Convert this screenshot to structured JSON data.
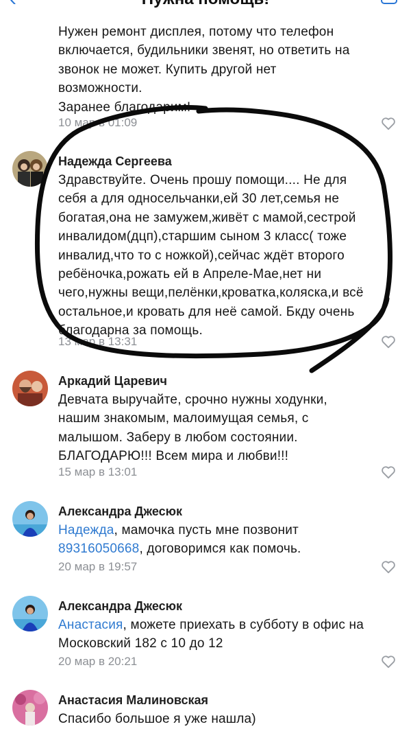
{
  "header": {
    "title": "Нужна помощь!"
  },
  "comments": [
    {
      "author": "",
      "lines": [
        "Нужен ремонт дисплея, потому что телефон",
        "включается, будильники звенят, но ответить на",
        "звонок не может. Купить другой нет",
        "возможности.",
        "Заранее благодарим!"
      ],
      "date": "10 мар в 01:09"
    },
    {
      "author": "Надежда Сергеева",
      "lines": [
        "Здравствуйте. Очень прошу помощи.... Не для",
        "себя а для односельчанки,ей 30 лет,семья не",
        "богатая,она не замужем,живёт с мамой,сестрой",
        "инвалидом(дцп),старшим сыном 3 класс( тоже",
        "инвалид,что то с ножкой),сейчас ждёт второго",
        "ребёночка,рожать ей в Апреле-Мае,нет ни",
        "чего,нужны вещи,пелёнки,кроватка,коляска,и всё",
        "остальное,и кровать для неё самой. Бкду очень",
        "благодарна за помощь."
      ],
      "date": "13 мар в 13:31"
    },
    {
      "author": "Аркадий Царевич",
      "lines": [
        "Девчата выручайте, срочно нужны ходунки,",
        "нашим знакомым, малоимущая семья, с",
        "малышом. Заберу в любом состоянии.",
        "БЛАГОДАРЮ!!! Всем мира и любви!!!"
      ],
      "date": "15 мар в 13:01"
    },
    {
      "author": "Александра Джесюк",
      "mention": "Надежда",
      "line1_rest": ", мамочка пусть мне позвонит",
      "phone": "89316050668",
      "line2_rest": ", договоримся как помочь.",
      "date": "20 мар в 19:57"
    },
    {
      "author": "Александра Джесюк",
      "mention": "Анастасия",
      "line1_rest": ", можете приехать в субботу в офис на",
      "line2": "Московский 182 с 10 до 12",
      "date": "20 мар в 20:21"
    },
    {
      "author": "Анастасия Малиновская",
      "lines": [
        "Спасибо большое я уже нашла)"
      ],
      "date": ""
    }
  ],
  "icons": {
    "like": "heart-outline-icon",
    "back": "chevron-left-icon",
    "menu": "square-menu-icon"
  },
  "colors": {
    "link": "#2f7ad0",
    "date": "#8c8f94",
    "ink": "#0b0b0b"
  }
}
